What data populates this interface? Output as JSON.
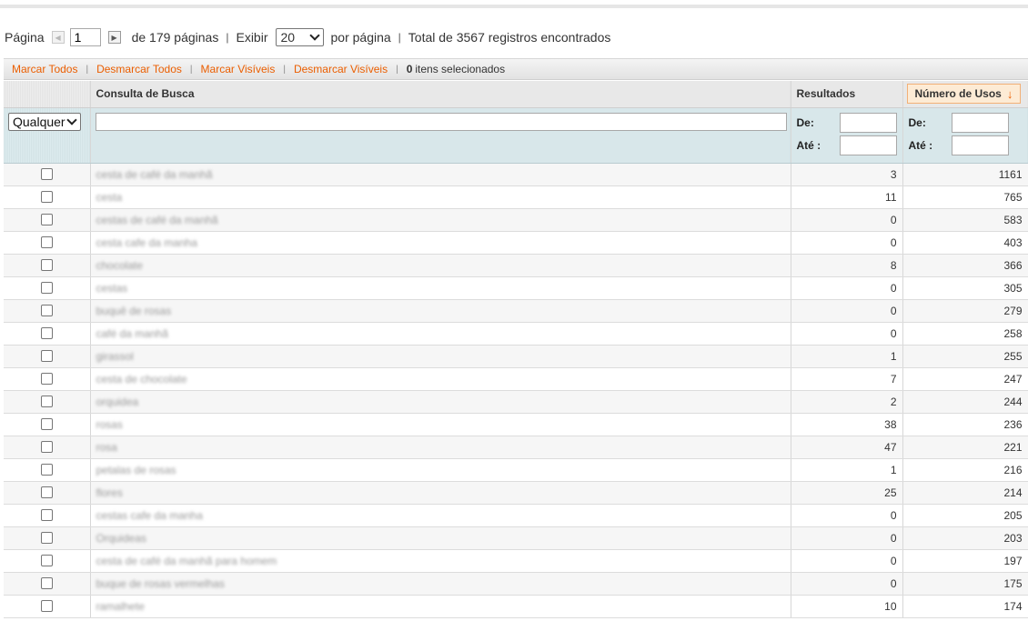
{
  "pager": {
    "page_label": "Página",
    "page_value": "1",
    "of_pages": "de 179 páginas",
    "sep": "|",
    "show_label": "Exibir",
    "per_page_value": "20",
    "per_page_label": "por página",
    "total": "Total de 3567 registros encontrados"
  },
  "massaction": {
    "select_all": "Marcar Todos",
    "unselect_all": "Desmarcar Todos",
    "select_visible": "Marcar Visíveis",
    "unselect_visible": "Desmarcar Visíveis",
    "selected_count": "0",
    "selected_label": "itens selecionados"
  },
  "columns": {
    "query": "Consulta de Busca",
    "results": "Resultados",
    "uses": "Número de Usos",
    "sort_arrow": "↓"
  },
  "filters": {
    "any_option": "Qualquer",
    "from_label": "De:",
    "to_label": "Até :"
  },
  "rows": [
    {
      "query": "cesta de café da manhã",
      "results": "3",
      "uses": "1161"
    },
    {
      "query": "cesta",
      "results": "11",
      "uses": "765"
    },
    {
      "query": "cestas de café da manhã",
      "results": "0",
      "uses": "583"
    },
    {
      "query": "cesta cafe da manha",
      "results": "0",
      "uses": "403"
    },
    {
      "query": "chocolate",
      "results": "8",
      "uses": "366"
    },
    {
      "query": "cestas",
      "results": "0",
      "uses": "305"
    },
    {
      "query": "buquê de rosas",
      "results": "0",
      "uses": "279"
    },
    {
      "query": "café da manhã",
      "results": "0",
      "uses": "258"
    },
    {
      "query": "girassol",
      "results": "1",
      "uses": "255"
    },
    {
      "query": "cesta de chocolate",
      "results": "7",
      "uses": "247"
    },
    {
      "query": "orquidea",
      "results": "2",
      "uses": "244"
    },
    {
      "query": "rosas",
      "results": "38",
      "uses": "236"
    },
    {
      "query": "rosa",
      "results": "47",
      "uses": "221"
    },
    {
      "query": "petalas de rosas",
      "results": "1",
      "uses": "216"
    },
    {
      "query": "flores",
      "results": "25",
      "uses": "214"
    },
    {
      "query": "cestas cafe da manha",
      "results": "0",
      "uses": "205"
    },
    {
      "query": "Orquideas",
      "results": "0",
      "uses": "203"
    },
    {
      "query": "cesta de café da manhã para homem",
      "results": "0",
      "uses": "197"
    },
    {
      "query": "buque de rosas vermelhas",
      "results": "0",
      "uses": "175"
    },
    {
      "query": "ramalhete",
      "results": "10",
      "uses": "174"
    }
  ],
  "colors": {
    "accent": "#eb5e00",
    "filter_bg": "#dcebee",
    "sorted_bg": "#fdebd5"
  }
}
